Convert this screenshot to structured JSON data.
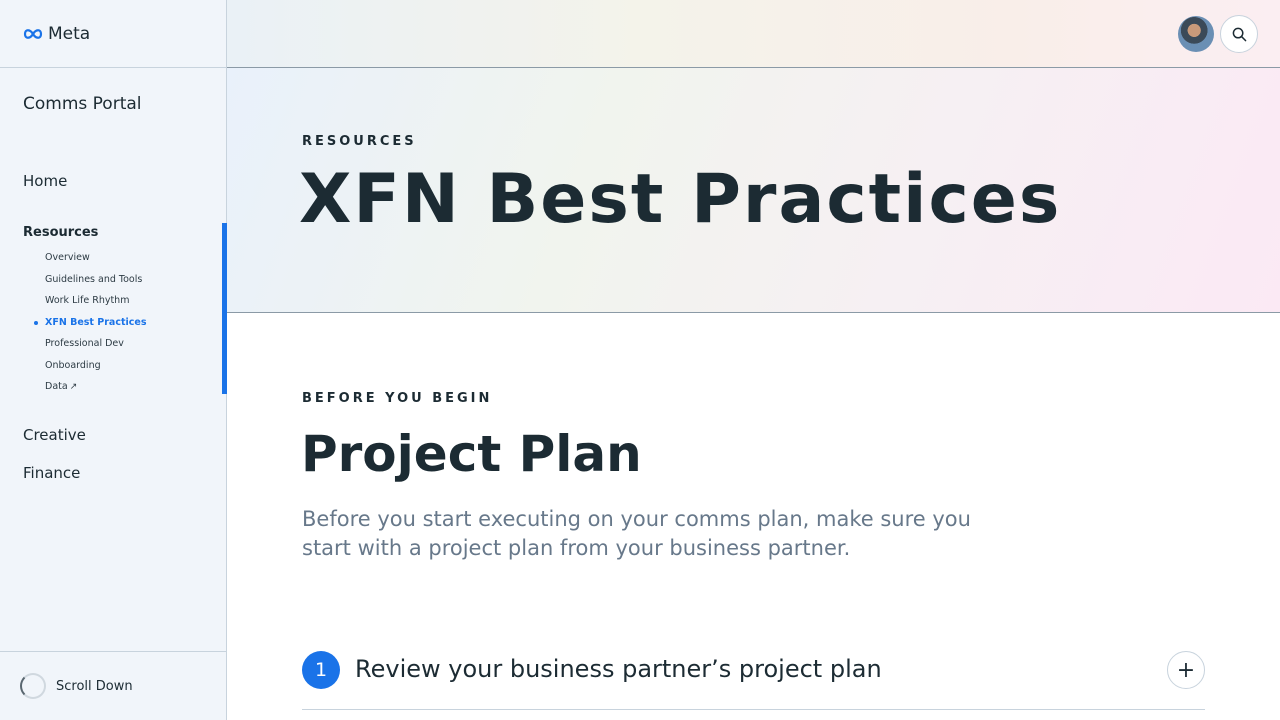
{
  "brand": {
    "logo_text": "Meta",
    "accent_color": "#1a73e8"
  },
  "sidebar": {
    "portal_title": "Comms Portal",
    "nav": {
      "home": "Home",
      "resources": "Resources",
      "creative": "Creative",
      "finance": "Finance"
    },
    "sub_items": [
      {
        "label": "Overview"
      },
      {
        "label": "Guidelines and Tools"
      },
      {
        "label": "Work Life Rhythm"
      },
      {
        "label": "XFN Best Practices",
        "active": true
      },
      {
        "label": "Professional Dev"
      },
      {
        "label": "Onboarding"
      },
      {
        "label": "Data",
        "icon": "external-arrow-icon",
        "arrow": "↗"
      }
    ],
    "scroll_label": "Scroll Down"
  },
  "header": {
    "avatar_icon": "user-avatar",
    "search_icon": "search-icon"
  },
  "hero": {
    "eyebrow": "RESOURCES",
    "title": "XFN Best Practices"
  },
  "section": {
    "eyebrow": "BEFORE YOU BEGIN",
    "title": "Project Plan",
    "description": "Before you start executing on your comms plan, make sure you start with a project plan from your business partner."
  },
  "steps": [
    {
      "number": "1",
      "title": "Review your business partner’s project plan",
      "toggle": "+"
    }
  ]
}
